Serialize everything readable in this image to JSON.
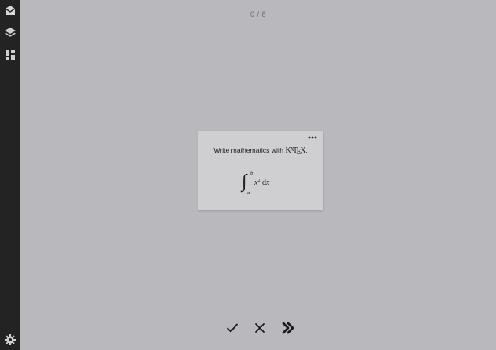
{
  "counter": {
    "current": "0",
    "separator": "/",
    "total": "8",
    "text": "0 / 8"
  },
  "sidebar": {
    "items": [
      {
        "icon": "inbox-icon"
      },
      {
        "icon": "layers-icon"
      },
      {
        "icon": "dashboard-icon"
      }
    ],
    "footer": {
      "icon": "gear-icon"
    }
  },
  "card": {
    "front": {
      "text": "Write mathematics with",
      "logo": {
        "k": "K",
        "a": "A",
        "t": "T",
        "e": "E",
        "x": "X",
        "trailing": "."
      }
    },
    "back": {
      "integral_sign": "∫",
      "upper": "b",
      "lower": "a",
      "var": "x",
      "exp": "2",
      "d": "d",
      "dvar": "x"
    },
    "menu_icon": "ellipsis-icon"
  },
  "actions": [
    {
      "icon": "check-icon"
    },
    {
      "icon": "close-icon"
    },
    {
      "icon": "skip-icon"
    }
  ],
  "colors": {
    "background": "#b9b8bc",
    "sidebar": "#232323",
    "sidebar_icon": "#d0d0d0",
    "card": "#cfcfd1",
    "text": "#222222",
    "muted": "#6b6b6f"
  }
}
